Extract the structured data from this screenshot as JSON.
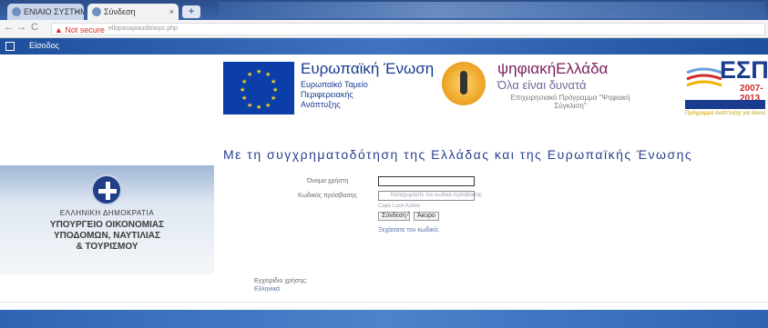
{
  "browser": {
    "tabs": [
      {
        "label": "ΕΝΙΑΙΟ ΣΥΣΤΗΜΑ ΠΛΗ",
        "close": "×"
      },
      {
        "label": "Σύνδεση",
        "close": "×"
      }
    ],
    "new_tab_label": "+",
    "nav": {
      "back": "←",
      "forward": "→",
      "reload": "C"
    },
    "url_warning": "▲ Not secure",
    "url": "ellopasapiaudit/arps.php"
  },
  "menubar": {
    "label": "Είσοδος"
  },
  "banner": {
    "eu_title": "Ευρωπαϊκή Ένωση",
    "eu_fund": "Ευρωπαϊκό Ταμείο Περιφερειακής Ανάπτυξης",
    "digital_title": "ψηφιακήΕλλάδα",
    "digital_sub": "Όλα είναι δυνατά",
    "digital_small": "Επιχειρησιακό Πρόγραμμα \"Ψηφιακή Σύγκλιση\"",
    "espa_title": "ΕΣΠΑ",
    "espa_years": "2007-2013",
    "espa_footer": "Πρόγραμμα Ανάπτυξης για όλους",
    "cofund_text": "Με τη συγχρηματοδότηση της Ελλάδας και της Ευρωπαϊκής Ένωσης"
  },
  "left": {
    "state": "ΕΛΛΗΝΙΚΗ ΔΗΜΟΚΡΑΤΙΑ",
    "ministry": [
      "ΥΠΟΥΡΓΕΙΟ ΟΙΚΟΝΟΜΙΑΣ",
      "ΥΠΟΔΟΜΩΝ, ΝΑΥΤΙΛΙΑΣ",
      "& ΤΟΥΡΙΣΜΟΥ"
    ]
  },
  "login": {
    "username_label": "Όνομα χρήστη",
    "password_label": "Κωδικός πρόσβασης",
    "username_value": "",
    "password_value": "",
    "password_hint": "Καταχωρήστε τον κωδικό πρόσβασης",
    "caps_hint": "Caps Lock Active",
    "login_button": "Σύνδεση",
    "cancel_button": "Άκυρο",
    "forgot_link": "Ξεχάσατε τον κωδικό;",
    "help_title": "Εγχειρίδιο χρήσης:",
    "help_link": "Ελληνικά"
  },
  "colors": {
    "menubar": "#1e4f9c",
    "eu_blue": "#0b3ea8",
    "espa_blue": "#1b3c8e",
    "footer": "#2f64b2"
  }
}
